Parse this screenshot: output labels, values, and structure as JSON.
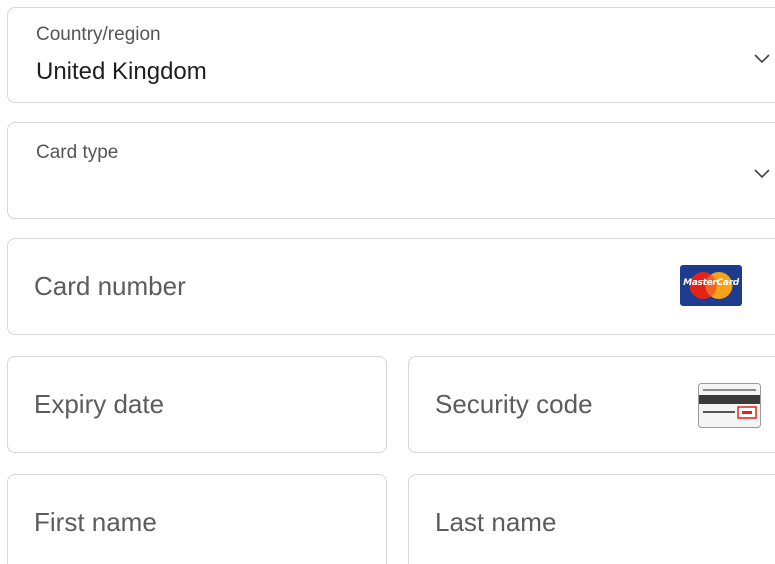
{
  "country": {
    "label": "Country/region",
    "value": "United Kingdom",
    "icon": "chevron-down-icon"
  },
  "card_type": {
    "label": "Card type",
    "value": "",
    "icon": "chevron-down-icon"
  },
  "card_number": {
    "placeholder": "Card number",
    "icon": "mastercard-icon",
    "icon_text": "MasterCard"
  },
  "expiry": {
    "placeholder": "Expiry date"
  },
  "security_code": {
    "placeholder": "Security code",
    "icon": "card-back-cvv-icon"
  },
  "first_name": {
    "placeholder": "First name"
  },
  "last_name": {
    "placeholder": "Last name"
  },
  "colors": {
    "border": "#d6d6d6",
    "text": "#1f1f1f",
    "placeholder": "#5c5c5c",
    "mastercard_bg": "#1d3c8f",
    "mastercard_red": "#e2231a",
    "mastercard_orange": "#f7a21b"
  }
}
